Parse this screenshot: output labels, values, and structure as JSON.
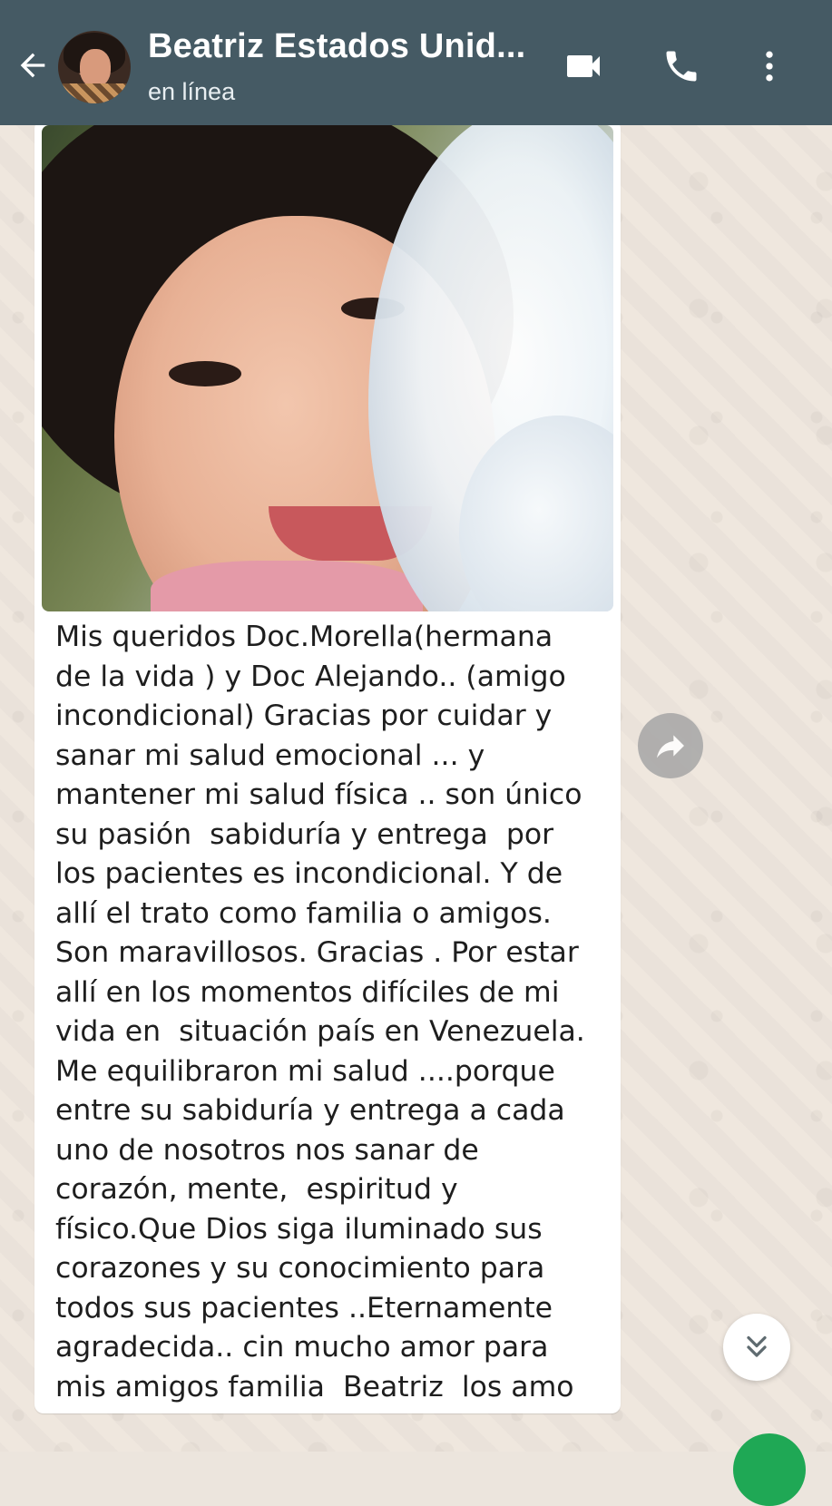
{
  "header": {
    "contact_name": "Beatriz Estados Unid...",
    "status": "en línea",
    "icons": {
      "back": "arrow-left-icon",
      "video": "video-camera-icon",
      "call": "phone-icon",
      "menu": "more-vertical-icon"
    },
    "background_color": "#455a64"
  },
  "message": {
    "image": "photo of a smiling woman with dark hair next to a white flower",
    "text": "Mis queridos Doc.Morella(hermana\nde la vida ) y Doc Alejando.. (amigo\nincondicional) Gracias por cuidar y\nsanar mi salud emocional ... y\nmantener mi salud física .. son único\nsu pasión  sabiduría y entrega  por\nlos pacientes es incondicional. Y de\nallí el trato como familia o amigos.\nSon maravillosos. Gracias . Por estar\nallí en los momentos difíciles de mi\nvida en  situación país en Venezuela.\nMe equilibraron mi salud ....porque\nentre su sabiduría y entrega a cada\nuno de nosotros nos sanar de\ncorazón, mente,  espiritud y\nfísico.Que Dios siga iluminado sus\ncorazones y su conocimiento para\ntodos sus pacientes ..Eternamente\nagradecida.. cin mucho amor para\nmis amigos familia  Beatriz  los amo"
  },
  "actions": {
    "forward_icon": "share-forward-icon",
    "scroll_down_icon": "double-chevron-down-icon"
  },
  "colors": {
    "chat_background": "#efe7de",
    "bubble": "#ffffff",
    "accent_green": "#1fa855"
  }
}
